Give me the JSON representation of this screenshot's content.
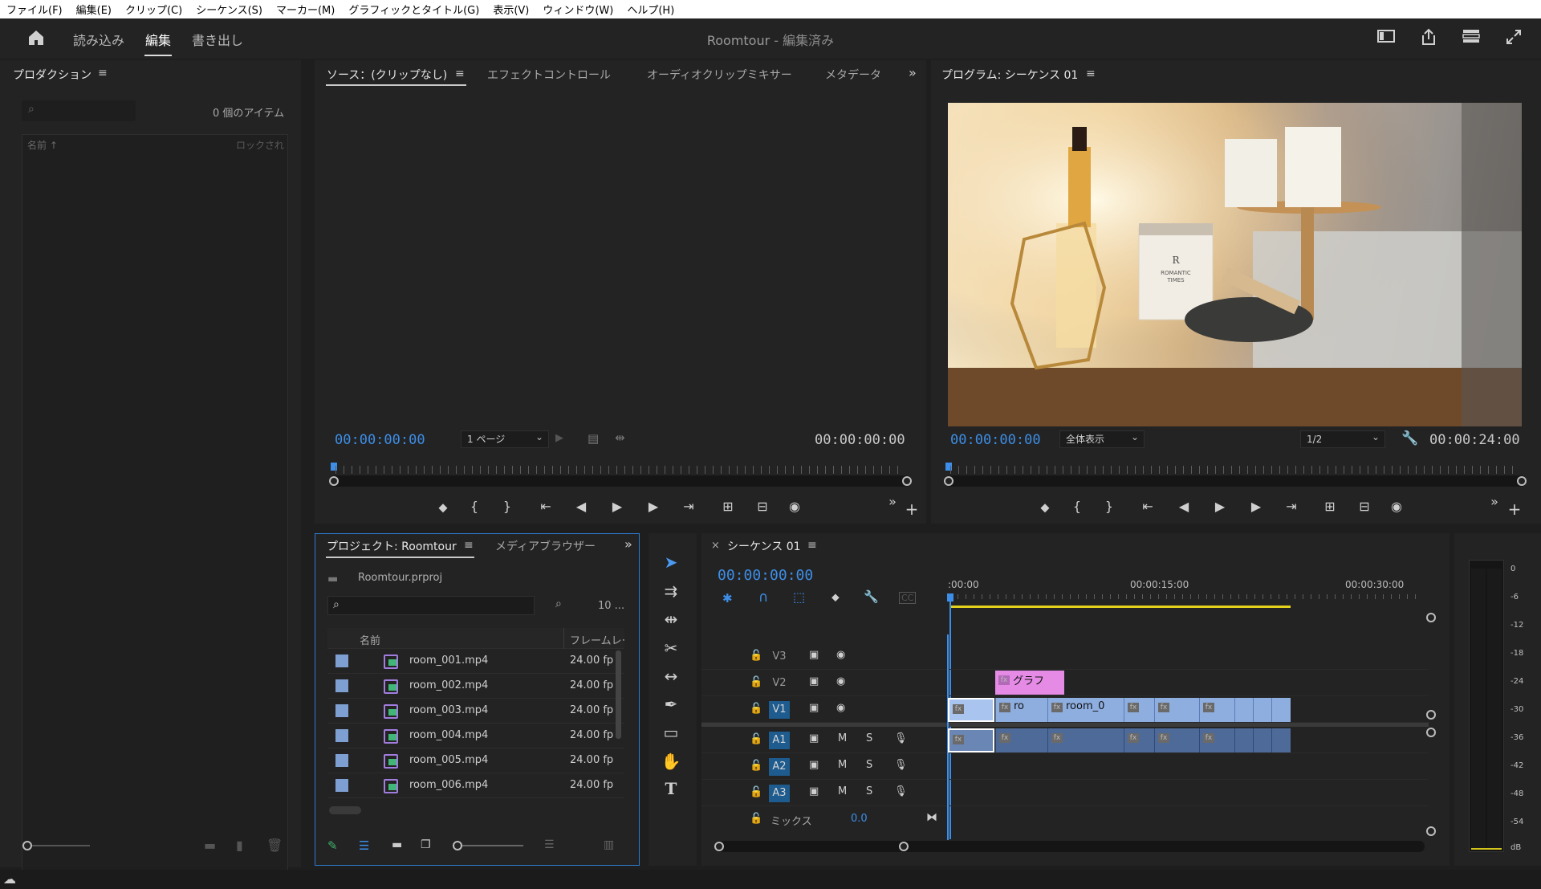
{
  "menu": [
    "ファイル(F)",
    "編集(E)",
    "クリップ(C)",
    "シーケンス(S)",
    "マーカー(M)",
    "グラフィックとタイトル(G)",
    "表示(V)",
    "ウィンドウ(W)",
    "ヘルプ(H)"
  ],
  "header": {
    "tabs": [
      "読み込み",
      "編集",
      "書き出し"
    ],
    "active_tab": "編集",
    "title": "Roomtour",
    "title_suffix": " - 編集済み",
    "icons": [
      "home-icon",
      "panel-layout-icon",
      "share-icon",
      "workspaces-icon",
      "fullscreen-icon"
    ]
  },
  "production": {
    "title": "プロダクション",
    "count": "0 個のアイテム",
    "col_name": "名前 ↑",
    "col_lock": "ロックされ"
  },
  "source": {
    "tabs": [
      "ソース：(クリップなし)",
      "エフェクトコントロール",
      "オーディオクリップミキサー",
      "メタデータ"
    ],
    "timecode": "00:00:00:00",
    "page_dropdown": "1 ページ",
    "duration": "00:00:00:00"
  },
  "program": {
    "title": "プログラム: シーケンス 01",
    "timecode": "00:00:00:00",
    "zoom": "全体表示",
    "resolution": "1/2",
    "duration": "00:00:24:00",
    "frame": {
      "label_brand": "R",
      "label_line1": "ROMANTIC",
      "label_line2": "TIMES"
    }
  },
  "project": {
    "tabs": [
      "プロジェクト: Roomtour",
      "メディアブラウザー"
    ],
    "file": "Roomtour.prproj",
    "count": "10 ...",
    "col_name": "名前",
    "col_fps": "フレームレー",
    "items": [
      {
        "name": "room_001.mp4",
        "fps": "24.00 fp"
      },
      {
        "name": "room_002.mp4",
        "fps": "24.00 fp"
      },
      {
        "name": "room_003.mp4",
        "fps": "24.00 fp"
      },
      {
        "name": "room_004.mp4",
        "fps": "24.00 fp"
      },
      {
        "name": "room_005.mp4",
        "fps": "24.00 fp"
      },
      {
        "name": "room_006.mp4",
        "fps": "24.00 fp"
      }
    ]
  },
  "timeline": {
    "close": "×",
    "title": "シーケンス 01",
    "timecode": "00:00:00:00",
    "ruler": [
      ":00:00",
      "00:00:15:00",
      "00:00:30:00"
    ],
    "video_tracks": [
      "V3",
      "V2",
      "V1"
    ],
    "audio_tracks": [
      "A1",
      "A2",
      "A3"
    ],
    "mute": "M",
    "solo": "S",
    "mix_label": "ミックス",
    "mix_value": "0.0",
    "graphic_clip": "グラフ",
    "clip_labels": [
      "ro",
      "room_0"
    ],
    "fx": "fx"
  },
  "meter": {
    "scale": [
      "0",
      "-6",
      "-12",
      "-18",
      "-24",
      "-30",
      "-36",
      "-42",
      "-48",
      "-54",
      "dB"
    ]
  },
  "colors": {
    "accent_blue": "#3d8ee8",
    "video_clip": "#8eaee0",
    "audio_clip": "#4d6a99",
    "graphic_clip": "#e58be6"
  }
}
